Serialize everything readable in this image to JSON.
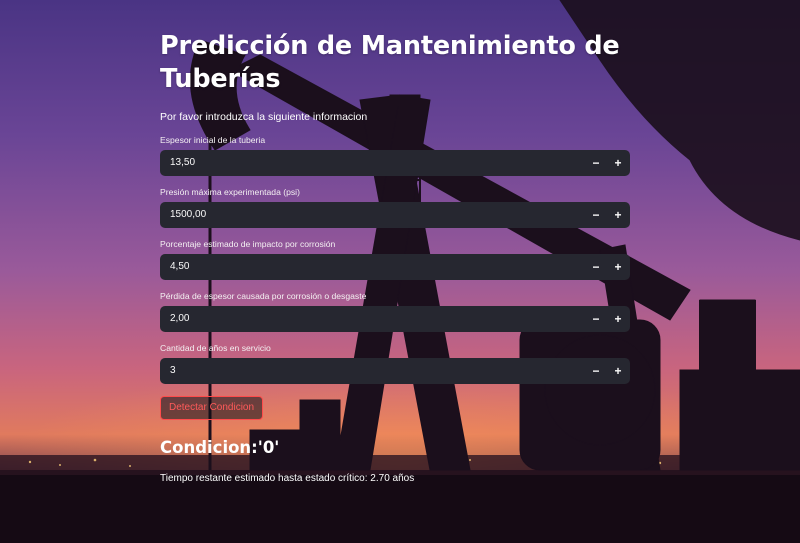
{
  "app": {
    "title": "Predicción de Mantenimiento de Tuberías",
    "subtitle": "Por favor introduzca la siguiente informacion"
  },
  "fields": [
    {
      "label": "Espesor inicial de la tuberia",
      "value": "13,50",
      "minus": "−",
      "plus": "+"
    },
    {
      "label": "Presión máxima experimentada (psi)",
      "value": "1500,00",
      "minus": "−",
      "plus": "+"
    },
    {
      "label": "Porcentaje estimado de impacto por corrosión",
      "value": "4,50",
      "minus": "−",
      "plus": "+"
    },
    {
      "label": "Pérdida de espesor causada por corrosión o desgaste",
      "value": "2,00",
      "minus": "−",
      "plus": "+"
    },
    {
      "label": "Cantidad de años en servicio",
      "value": "3",
      "minus": "−",
      "plus": "+"
    }
  ],
  "button": {
    "label": "Detectar Condicion"
  },
  "result": {
    "heading": "Condicion:'0'",
    "text": "Tiempo restante estimado hasta estado crítico: 2.70 años"
  },
  "colors": {
    "accent": "#ff4b4b",
    "input_bg": "#262730",
    "sky_top": "#5a3f8f",
    "sky_horizon": "#e06a5a"
  }
}
